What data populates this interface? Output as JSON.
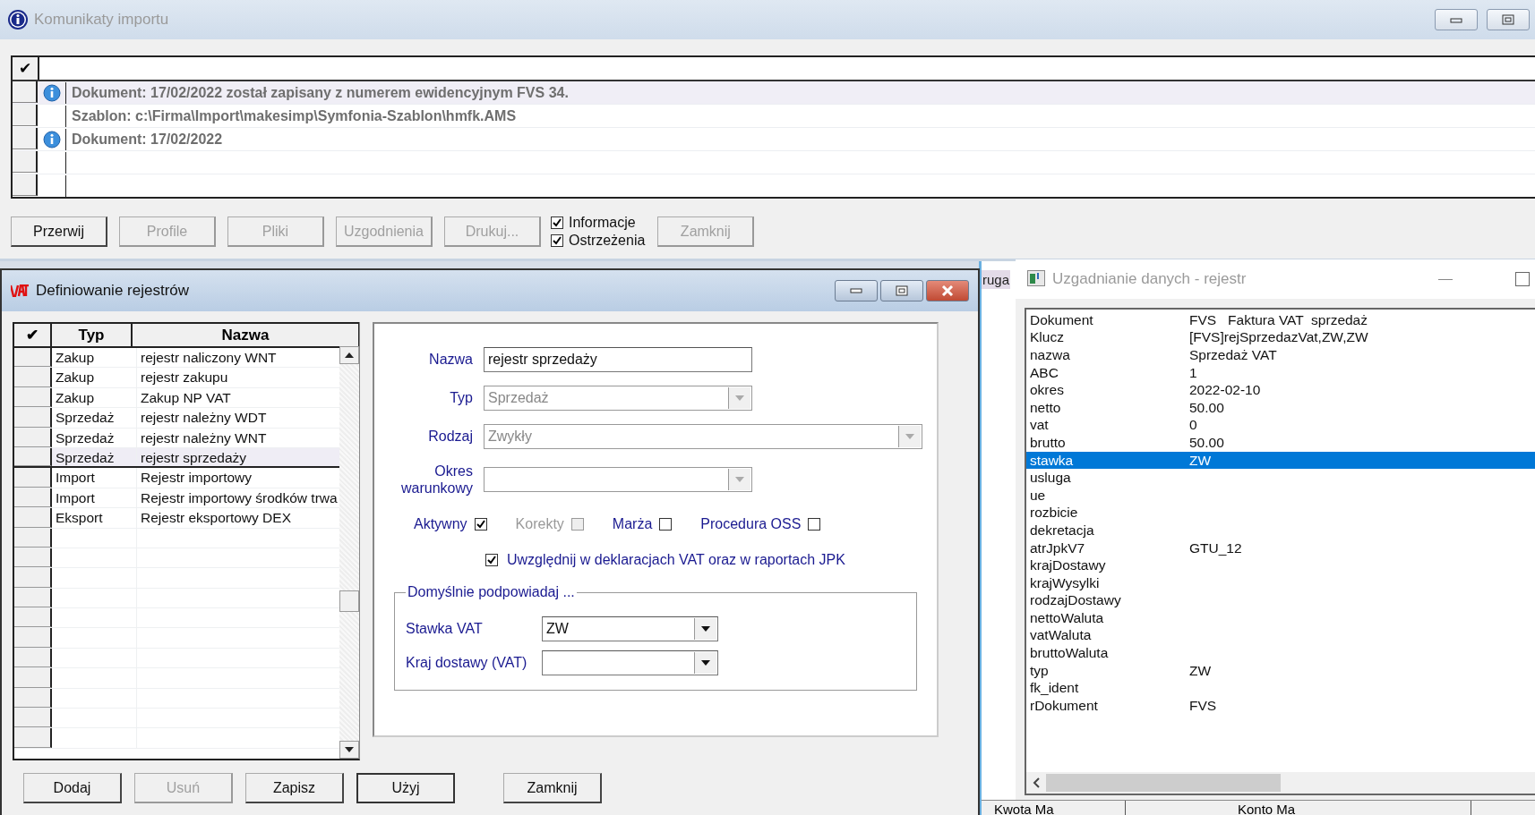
{
  "import_window": {
    "title": "Komunikaty importu",
    "check_header": "✔",
    "messages": [
      {
        "kind": "info",
        "text": "Dokument: 17/02/2022 został zapisany z numerem ewidencyjnym FVS 34.",
        "selected": true
      },
      {
        "kind": "plain",
        "text": "Szablon: c:\\Firma\\Import\\makesimp\\Symfonia-Szablon\\hmfk.AMS",
        "selected": false
      },
      {
        "kind": "info",
        "text": "Dokument: 17/02/2022",
        "selected": false
      }
    ],
    "buttons": [
      {
        "label": "Przerwij",
        "disabled": false
      },
      {
        "label": "Profile",
        "disabled": true
      },
      {
        "label": "Pliki",
        "disabled": true
      },
      {
        "label": "Uzgodnienia",
        "disabled": true
      },
      {
        "label": "Drukuj...",
        "disabled": true
      }
    ],
    "filters": [
      {
        "label": "Informacje",
        "checked": true
      },
      {
        "label": "Ostrzeżenia",
        "checked": true
      }
    ],
    "close_button": {
      "label": "Zamknij",
      "disabled": true
    }
  },
  "background_window": {
    "title_fragment": "ruga",
    "columns": [
      "Kwota Ma",
      "Konto Ma"
    ]
  },
  "register_dialog": {
    "title": "Definiowanie rejestrów",
    "check_header": "✔",
    "columns": [
      "Typ",
      "Nazwa"
    ],
    "rows": [
      {
        "typ": "Zakup",
        "nazwa": "rejestr naliczony WNT",
        "selected": false
      },
      {
        "typ": "Zakup",
        "nazwa": "rejestr zakupu",
        "selected": false
      },
      {
        "typ": "Zakup",
        "nazwa": "Zakup NP VAT",
        "selected": false
      },
      {
        "typ": "Sprzedaż",
        "nazwa": "rejestr należny WDT",
        "selected": false
      },
      {
        "typ": "Sprzedaż",
        "nazwa": "rejestr należny WNT",
        "selected": false
      },
      {
        "typ": "Sprzedaż",
        "nazwa": "rejestr sprzedaży",
        "selected": true
      },
      {
        "typ": "Import",
        "nazwa": "Rejestr importowy",
        "selected": false
      },
      {
        "typ": "Import",
        "nazwa": "Rejestr importowy środków trwa",
        "selected": false
      },
      {
        "typ": "Eksport",
        "nazwa": "Rejestr eksportowy DEX",
        "selected": false
      }
    ],
    "form": {
      "nazwa": {
        "label": "Nazwa",
        "value": "rejestr sprzedaży"
      },
      "typ": {
        "label": "Typ",
        "value": "Sprzedaż",
        "disabled": true
      },
      "rodzaj": {
        "label": "Rodzaj",
        "value": "Zwykły",
        "disabled": true
      },
      "okres": {
        "label": "Okres warunkowy",
        "disabled": true
      },
      "flags": [
        {
          "label": "Aktywny",
          "checked": true,
          "disabled": false
        },
        {
          "label": "Korekty",
          "checked": false,
          "disabled": true
        },
        {
          "label": "Marża",
          "checked": false,
          "disabled": false
        },
        {
          "label": "Procedura OSS",
          "checked": false,
          "disabled": false
        }
      ],
      "jpk": {
        "label": "Uwzględnij w deklaracjach VAT oraz w raportach JPK",
        "checked": true
      },
      "group": {
        "legend": "Domyślnie podpowiadaj ...",
        "stawka": {
          "label": "Stawka VAT",
          "value": "ZW"
        },
        "kraj": {
          "label": "Kraj dostawy (VAT)"
        }
      }
    },
    "buttons": [
      {
        "label": "Dodaj",
        "disabled": false
      },
      {
        "label": "Usuń",
        "disabled": true
      },
      {
        "label": "Zapisz",
        "disabled": false
      },
      {
        "label": "Użyj",
        "disabled": false,
        "default": true
      },
      {
        "label": "Zamknij",
        "disabled": false,
        "default": false
      }
    ]
  },
  "reconcile_window": {
    "title": "Uzgadnianie danych - rejestr",
    "rows": [
      {
        "key": "Dokument",
        "value": "FVS   Faktura VAT  sprzedaż",
        "selected": false
      },
      {
        "key": "Klucz",
        "value": "[FVS]rejSprzedazVat,ZW,ZW",
        "selected": false
      },
      {
        "key": "nazwa",
        "value": "Sprzedaż VAT",
        "selected": false
      },
      {
        "key": "ABC",
        "value": "1",
        "selected": false
      },
      {
        "key": "okres",
        "value": "2022-02-10",
        "selected": false
      },
      {
        "key": "netto",
        "value": "50.00",
        "selected": false
      },
      {
        "key": "vat",
        "value": "0",
        "selected": false
      },
      {
        "key": "brutto",
        "value": "50.00",
        "selected": false
      },
      {
        "key": "stawka",
        "value": "ZW",
        "selected": true
      },
      {
        "key": "usluga",
        "selected": false
      },
      {
        "key": "ue",
        "selected": false
      },
      {
        "key": "rozbicie",
        "selected": false
      },
      {
        "key": "dekretacja",
        "selected": false
      },
      {
        "key": "atrJpkV7",
        "value": "GTU_12",
        "selected": false
      },
      {
        "key": "krajDostawy",
        "selected": false
      },
      {
        "key": "krajWysylki",
        "selected": false
      },
      {
        "key": "rodzajDostawy",
        "selected": false
      },
      {
        "key": "nettoWaluta",
        "selected": false
      },
      {
        "key": "vatWaluta",
        "selected": false
      },
      {
        "key": "bruttoWaluta",
        "selected": false
      },
      {
        "key": "typ",
        "value": "ZW",
        "selected": false
      },
      {
        "key": "fk_ident",
        "selected": false
      },
      {
        "key": "rDokument",
        "value": "FVS",
        "selected": false
      }
    ]
  }
}
